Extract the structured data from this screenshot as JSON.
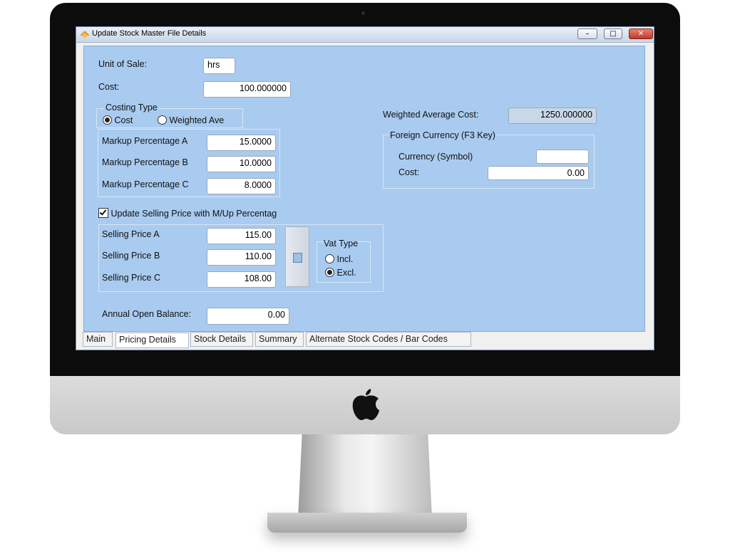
{
  "window": {
    "title": "Update Stock Master File Details",
    "controls": {
      "minimize": "–",
      "maximize": "□",
      "close": "✕"
    }
  },
  "form": {
    "unit_of_sale": {
      "label": "Unit of Sale:",
      "value": "hrs"
    },
    "cost": {
      "label": "Cost:",
      "value": "100.000000"
    },
    "costing_type": {
      "label": "Costing Type",
      "options": [
        "Cost",
        "Weighted Ave"
      ],
      "selected": "Cost"
    },
    "markup": [
      {
        "label": "Markup Percentage A",
        "value": "15.0000"
      },
      {
        "label": "Markup Percentage B",
        "value": "10.0000"
      },
      {
        "label": "Markup Percentage C",
        "value": "8.0000"
      }
    ],
    "update_selling_price": {
      "label": "Update Selling Price with M/Up Percentag",
      "checked": true
    },
    "selling_prices": [
      {
        "label": "Selling Price A",
        "value": "115.00"
      },
      {
        "label": "Selling Price B",
        "value": "110.00"
      },
      {
        "label": "Selling Price C",
        "value": "108.00"
      }
    ],
    "vat_type": {
      "label": "Vat Type",
      "options": [
        "Incl.",
        "Excl."
      ],
      "selected": "Excl."
    },
    "annual_open_balance": {
      "label": "Annual Open Balance:",
      "value": "0.00"
    },
    "weighted_average_cost": {
      "label": "Weighted Average Cost:",
      "value": "1250.000000"
    },
    "foreign_currency": {
      "label": "Foreign Currency (F3 Key)",
      "currency_label": "Currency (Symbol)",
      "currency_value": "",
      "cost_label": "Cost:",
      "cost_value": "0.00"
    }
  },
  "tabs": [
    "Main",
    "Pricing Details",
    "Stock Details",
    "Summary",
    "Alternate Stock Codes / Bar Codes"
  ],
  "active_tab": "Pricing Details",
  "colors": {
    "panel": "#a9cbf0",
    "bezel": "#0c0c0c",
    "chin": "#d2d2d2"
  },
  "icons": {
    "app": "app-icon",
    "apple": "apple-logo",
    "calculator": "calculator-icon"
  }
}
